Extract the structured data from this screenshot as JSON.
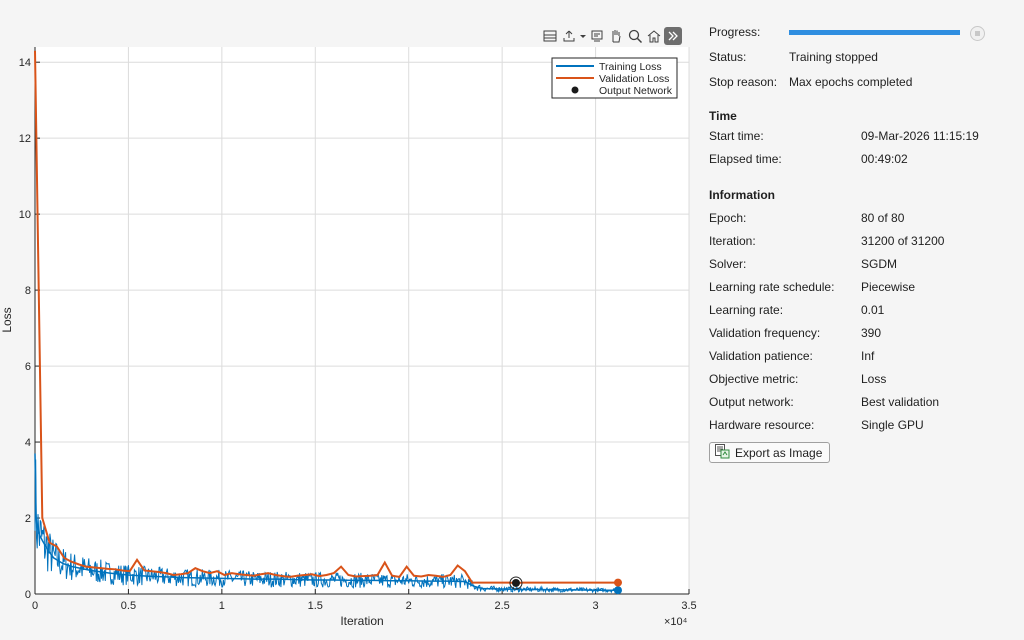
{
  "chart_data": {
    "type": "line",
    "xlabel": "Iteration",
    "ylabel": "Loss",
    "x_exponent_label": "×10⁴",
    "xlim": [
      0,
      35000
    ],
    "ylim": [
      0,
      14.4
    ],
    "grid": true,
    "legend_position": "top-right",
    "x_ticks": [
      0,
      5000,
      10000,
      15000,
      20000,
      25000,
      30000,
      35000
    ],
    "x_tick_labels": [
      "0",
      "0.5",
      "1",
      "1.5",
      "2",
      "2.5",
      "3",
      "3.5"
    ],
    "y_ticks": [
      0,
      2,
      4,
      6,
      8,
      10,
      12,
      14
    ],
    "y_tick_labels": [
      "0",
      "2",
      "4",
      "6",
      "8",
      "10",
      "12",
      "14"
    ],
    "series": [
      {
        "name": "Training Loss",
        "color": "#0072bd",
        "x": [
          0,
          50,
          100,
          200,
          400,
          700,
          1000,
          1500,
          2000,
          3000,
          4000,
          5000,
          6000,
          7000,
          8000,
          9000,
          10000,
          11000,
          12000,
          13000,
          14000,
          15000,
          16000,
          17000,
          18000,
          19000,
          20000,
          21000,
          22000,
          23000,
          23500,
          24000,
          25000,
          26000,
          27000,
          28000,
          29000,
          30000,
          31000,
          31200
        ],
        "values": [
          3.7,
          2.1,
          1.8,
          1.6,
          1.4,
          1.15,
          0.95,
          0.8,
          0.72,
          0.62,
          0.55,
          0.5,
          0.47,
          0.45,
          0.43,
          0.42,
          0.41,
          0.4,
          0.39,
          0.39,
          0.38,
          0.37,
          0.37,
          0.36,
          0.36,
          0.35,
          0.35,
          0.34,
          0.34,
          0.33,
          0.2,
          0.14,
          0.13,
          0.12,
          0.12,
          0.11,
          0.11,
          0.1,
          0.1,
          0.1
        ]
      },
      {
        "name": "Validation Loss",
        "color": "#d95319",
        "x": [
          0,
          390,
          780,
          1170,
          1560,
          1950,
          2340,
          2730,
          3120,
          3510,
          3900,
          4290,
          4680,
          5070,
          5460,
          5850,
          6240,
          6630,
          7020,
          7410,
          7800,
          8190,
          8580,
          8970,
          9360,
          9750,
          10140,
          10530,
          10920,
          11310,
          11700,
          12090,
          12480,
          12870,
          13260,
          13650,
          14040,
          14430,
          14820,
          15210,
          15600,
          15990,
          16380,
          16770,
          17160,
          17550,
          17940,
          18330,
          18720,
          19110,
          19500,
          19890,
          20280,
          20670,
          21060,
          21450,
          21840,
          22230,
          22620,
          23010,
          23400,
          23790,
          24180,
          24570,
          24960,
          25350,
          25740,
          26130,
          26520,
          26910,
          27300,
          27690,
          28080,
          28470,
          28860,
          29250,
          29640,
          30030,
          30420,
          30810,
          31200
        ],
        "values": [
          14.3,
          2.0,
          1.35,
          1.25,
          0.95,
          0.85,
          0.78,
          0.72,
          0.7,
          0.68,
          0.66,
          0.65,
          0.62,
          0.6,
          0.9,
          0.62,
          0.6,
          0.58,
          0.55,
          0.5,
          0.52,
          0.55,
          0.68,
          0.6,
          0.55,
          0.6,
          0.5,
          0.55,
          0.52,
          0.5,
          0.48,
          0.52,
          0.55,
          0.5,
          0.47,
          0.45,
          0.48,
          0.5,
          0.52,
          0.47,
          0.5,
          0.55,
          0.72,
          0.5,
          0.46,
          0.47,
          0.48,
          0.5,
          0.83,
          0.48,
          0.45,
          0.72,
          0.48,
          0.46,
          0.5,
          0.48,
          0.45,
          0.5,
          0.75,
          0.6,
          0.3,
          0.3,
          0.3,
          0.3,
          0.3,
          0.3,
          0.29,
          0.3,
          0.3,
          0.3,
          0.3,
          0.3,
          0.3,
          0.3,
          0.3,
          0.3,
          0.3,
          0.3,
          0.3,
          0.3,
          0.3
        ]
      }
    ],
    "output_network": {
      "name": "Output Network",
      "x": 25740,
      "y": 0.29
    },
    "final_points": [
      {
        "series": "Training Loss",
        "x": 31200,
        "y": 0.1
      },
      {
        "series": "Validation Loss",
        "x": 31200,
        "y": 0.3
      }
    ]
  },
  "toolbar": {
    "icons": [
      "data-tips-icon",
      "export-axes-icon",
      "brush-icon",
      "pan-icon",
      "zoom-icon",
      "home-icon",
      "collapse-icon"
    ]
  },
  "panel": {
    "progress_label": "Progress:",
    "progress_fraction": 1.0,
    "status_label": "Status:",
    "status_value": "Training stopped",
    "stop_reason_label": "Stop reason:",
    "stop_reason_value": "Max epochs completed",
    "time_heading": "Time",
    "start_time_label": "Start time:",
    "start_time_value": "09-Mar-2026 11:15:19",
    "elapsed_label": "Elapsed time:",
    "elapsed_value": "00:49:02",
    "info_heading": "Information",
    "info_rows": [
      {
        "label": "Epoch:",
        "value": "80 of 80"
      },
      {
        "label": "Iteration:",
        "value": "31200 of 31200"
      },
      {
        "label": "Solver:",
        "value": "SGDM"
      },
      {
        "label": "Learning rate schedule:",
        "value": "Piecewise"
      },
      {
        "label": "Learning rate:",
        "value": "0.01"
      },
      {
        "label": "Validation frequency:",
        "value": "390"
      },
      {
        "label": "Validation patience:",
        "value": "Inf"
      },
      {
        "label": "Objective metric:",
        "value": "Loss"
      },
      {
        "label": "Output network:",
        "value": "Best validation"
      },
      {
        "label": "Hardware resource:",
        "value": "Single GPU"
      }
    ],
    "export_button_label": "Export as Image"
  }
}
